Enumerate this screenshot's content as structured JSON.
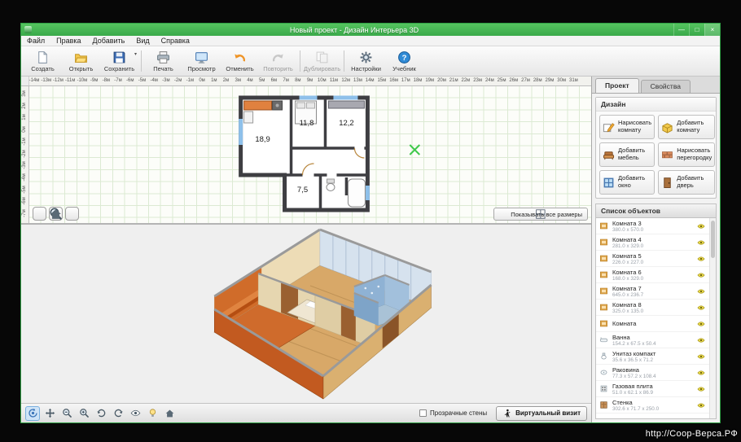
{
  "window": {
    "title": "Новый проект - Дизайн Интерьера 3D",
    "controls": {
      "minimize": "—",
      "maximize": "□",
      "close": "×"
    }
  },
  "watermark": "http://Coop-Bepca.РФ",
  "menu": {
    "items": [
      {
        "id": "file",
        "label": "Файл"
      },
      {
        "id": "edit",
        "label": "Правка"
      },
      {
        "id": "add",
        "label": "Добавить"
      },
      {
        "id": "view",
        "label": "Вид"
      },
      {
        "id": "help",
        "label": "Справка"
      }
    ]
  },
  "toolbar": {
    "groups": [
      [
        {
          "id": "new",
          "icon": "new",
          "label": "Создать"
        },
        {
          "id": "open",
          "icon": "open",
          "label": "Открыть"
        },
        {
          "id": "save",
          "icon": "save",
          "label": "Сохранить",
          "dropdown": true
        }
      ],
      [
        {
          "id": "print",
          "icon": "print",
          "label": "Печать"
        },
        {
          "id": "preview",
          "icon": "preview",
          "label": "Просмотр"
        },
        {
          "id": "undo",
          "icon": "undo",
          "label": "Отменить"
        },
        {
          "id": "redo",
          "icon": "redo",
          "label": "Повторить",
          "disabled": true
        }
      ],
      [
        {
          "id": "duplicate",
          "icon": "duplicate",
          "label": "Дублировать",
          "disabled": true
        }
      ],
      [
        {
          "id": "settings",
          "icon": "settings",
          "label": "Настройки"
        },
        {
          "id": "tutorial",
          "icon": "tutorial",
          "label": "Учебник"
        }
      ]
    ]
  },
  "ruler": {
    "unit": "м",
    "h_labels": [
      "-14м",
      "-13м",
      "-12м",
      "-11м",
      "-10м",
      "-9м",
      "-8м",
      "-7м",
      "-6м",
      "-5м",
      "-4м",
      "-3м",
      "-2м",
      "-1м",
      "0м",
      "1м",
      "2м",
      "3м",
      "4м",
      "5м",
      "6м",
      "7м",
      "8м",
      "9м",
      "10м",
      "11м",
      "12м",
      "13м",
      "14м",
      "15м",
      "16м",
      "17м",
      "18м",
      "19м",
      "20м",
      "21м",
      "22м",
      "23м",
      "24м",
      "25м",
      "26м",
      "27м",
      "28м",
      "29м",
      "30м",
      "31м"
    ],
    "v_labels": [
      "3м",
      "2м",
      "1м",
      "0м",
      "-1м",
      "-2м",
      "-3м",
      "-4м",
      "-5м",
      "-6м",
      "-7м"
    ]
  },
  "plan2d": {
    "rooms": [
      {
        "area": "18,9"
      },
      {
        "area": "11,8"
      },
      {
        "area": "12,2"
      },
      {
        "area": "7,5"
      }
    ],
    "zoom_tools": [
      {
        "id": "zoom-out-2d",
        "icon": "zoom-out"
      },
      {
        "id": "zoom-in-2d",
        "icon": "zoom-in"
      },
      {
        "id": "home-2d",
        "icon": "home"
      }
    ],
    "show_sizes_label": "Показывать все размеры"
  },
  "view3d": {
    "tools": [
      {
        "id": "orbit",
        "icon": "orbit",
        "active": true
      },
      {
        "id": "pan",
        "icon": "pan"
      },
      {
        "id": "zoom-out-3d",
        "icon": "zoom-out"
      },
      {
        "id": "zoom-in-3d",
        "icon": "zoom-in"
      },
      {
        "id": "rotate-left",
        "icon": "rotate-left"
      },
      {
        "id": "rotate-right",
        "icon": "rotate-right"
      },
      {
        "id": "view-mode",
        "icon": "eye"
      },
      {
        "id": "lighting",
        "icon": "light"
      },
      {
        "id": "home-3d",
        "icon": "home"
      }
    ],
    "transparent_walls_label": "Прозрачные стены",
    "transparent_walls_checked": false,
    "virtual_tour_label": "Виртуальный визит"
  },
  "panel": {
    "tabs": [
      {
        "id": "project",
        "label": "Проект",
        "active": true
      },
      {
        "id": "properties",
        "label": "Свойства",
        "active": false
      }
    ],
    "design_title": "Дизайн",
    "design_buttons": [
      {
        "id": "draw-room",
        "icon": "draw-room",
        "label": "Нарисовать комнату"
      },
      {
        "id": "add-room",
        "icon": "add-room",
        "label": "Добавить комнату"
      },
      {
        "id": "add-furniture",
        "icon": "add-furniture",
        "label": "Добавить мебель"
      },
      {
        "id": "draw-partition",
        "icon": "draw-partition",
        "label": "Нарисовать перегородку"
      },
      {
        "id": "add-window",
        "icon": "add-window",
        "label": "Добавить окно"
      },
      {
        "id": "add-door",
        "icon": "add-door",
        "label": "Добавить дверь"
      }
    ],
    "objects_title": "Список объектов",
    "objects": [
      {
        "icon": "room",
        "name": "Комната 3",
        "dims": "380.0 x 570.0"
      },
      {
        "icon": "room",
        "name": "Комната 4",
        "dims": "281.0 x 329.0"
      },
      {
        "icon": "room",
        "name": "Комната 5",
        "dims": "226.0 x 227.0"
      },
      {
        "icon": "room",
        "name": "Комната 6",
        "dims": "168.0 x 329.0"
      },
      {
        "icon": "room",
        "name": "Комната 7",
        "dims": "645.0 x 236.7"
      },
      {
        "icon": "room",
        "name": "Комната 8",
        "dims": "325.0 x 135.0"
      },
      {
        "icon": "room",
        "name": "Комната",
        "dims": ""
      },
      {
        "icon": "bath",
        "name": "Ванна",
        "dims": "154.2 x 67.5 x 50.4"
      },
      {
        "icon": "toilet",
        "name": "Унитаз компакт",
        "dims": "35.6 x 36.5 x 71.2"
      },
      {
        "icon": "sink",
        "name": "Раковина",
        "dims": "77.3 x 57.2 x 108.4"
      },
      {
        "icon": "stove",
        "name": "Газовая плита",
        "dims": "51.0 x 62.1 x 86.9"
      },
      {
        "icon": "cabinet",
        "name": "Стенка",
        "dims": "302.6 x 71.7 x 250.0"
      }
    ]
  },
  "colors": {
    "titlebar_green": "#3aa94a",
    "grid_line": "#dcead3",
    "wall": "#3e3e42",
    "cursor_green": "#3ec84a",
    "eye_yellow": "#e8d84a",
    "floor_orange": "#cf6b2c",
    "floor_wood": "#d8a868"
  }
}
